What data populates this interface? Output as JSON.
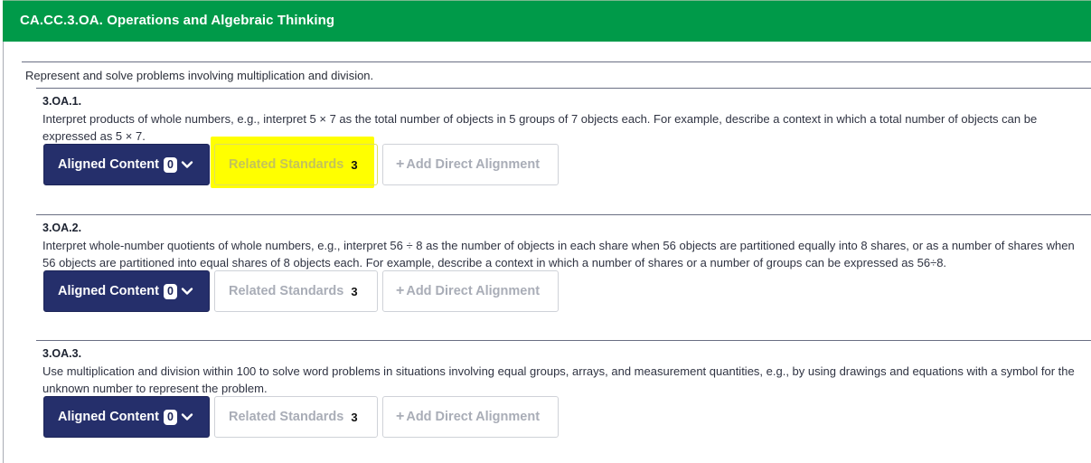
{
  "header": {
    "title": "CA.CC.3.OA. Operations and Algebraic Thinking",
    "bg_color": "#009a49"
  },
  "domain": {
    "description": "Represent and solve problems involving multiplication and division."
  },
  "standards": [
    {
      "code": "3.OA.1.",
      "description": "Interpret products of whole numbers, e.g., interpret 5 × 7 as the total number of objects in 5 groups of 7 objects each. For example, describe a context in which a total number of objects can be expressed as 5 × 7.",
      "aligned_label": "Aligned Content",
      "aligned_count": "0",
      "related_label": "Related Standards",
      "related_count": "3",
      "add_label": "Add Direct Alignment",
      "related_highlighted": true
    },
    {
      "code": "3.OA.2.",
      "description": "Interpret whole-number quotients of whole numbers, e.g., interpret 56 ÷ 8 as the number of objects in each share when 56 objects are partitioned equally into 8 shares, or as a number of shares when 56 objects are partitioned into equal shares of 8 objects each. For example, describe a context in which a number of shares or a number of groups can be expressed as 56÷8.",
      "aligned_label": "Aligned Content",
      "aligned_count": "0",
      "related_label": "Related Standards",
      "related_count": "3",
      "add_label": "Add Direct Alignment",
      "related_highlighted": false
    },
    {
      "code": "3.OA.3.",
      "description": "Use multiplication and division within 100 to solve word problems in situations involving equal groups, arrays, and measurement quantities, e.g., by using drawings and equations with a symbol for the unknown number to represent the problem.",
      "aligned_label": "Aligned Content",
      "aligned_count": "0",
      "related_label": "Related Standards",
      "related_count": "3",
      "add_label": "Add Direct Alignment",
      "related_highlighted": false
    }
  ],
  "icons": {
    "chevron": "chevron-down-icon",
    "plus": "plus-icon"
  },
  "colors": {
    "aligned_button": "#252f6b",
    "highlight": "#ffff00"
  }
}
